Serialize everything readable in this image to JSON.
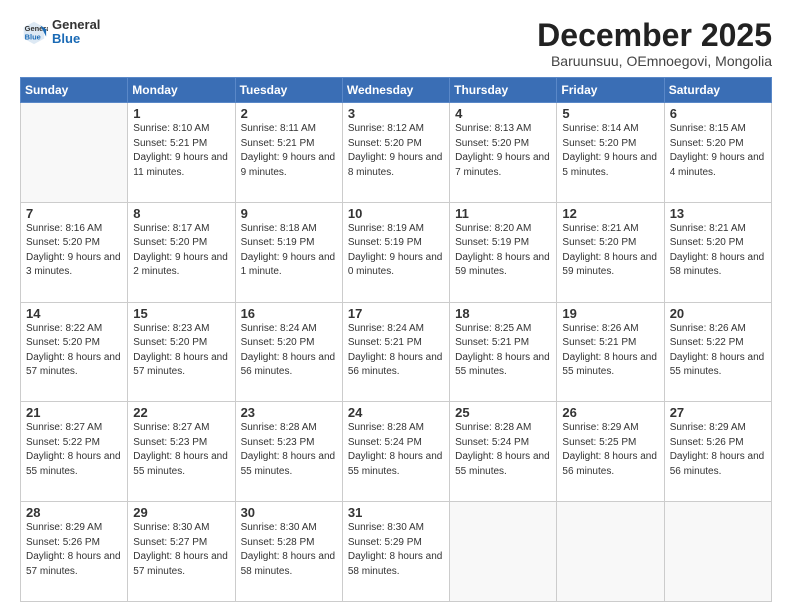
{
  "header": {
    "logo_general": "General",
    "logo_blue": "Blue",
    "month_title": "December 2025",
    "subtitle": "Baruunsuu, OEmnoegovi, Mongolia"
  },
  "days_of_week": [
    "Sunday",
    "Monday",
    "Tuesday",
    "Wednesday",
    "Thursday",
    "Friday",
    "Saturday"
  ],
  "weeks": [
    [
      {
        "day": "",
        "empty": true
      },
      {
        "day": "1",
        "sunrise": "8:10 AM",
        "sunset": "5:21 PM",
        "daylight": "9 hours and 11 minutes."
      },
      {
        "day": "2",
        "sunrise": "8:11 AM",
        "sunset": "5:21 PM",
        "daylight": "9 hours and 9 minutes."
      },
      {
        "day": "3",
        "sunrise": "8:12 AM",
        "sunset": "5:20 PM",
        "daylight": "9 hours and 8 minutes."
      },
      {
        "day": "4",
        "sunrise": "8:13 AM",
        "sunset": "5:20 PM",
        "daylight": "9 hours and 7 minutes."
      },
      {
        "day": "5",
        "sunrise": "8:14 AM",
        "sunset": "5:20 PM",
        "daylight": "9 hours and 5 minutes."
      },
      {
        "day": "6",
        "sunrise": "8:15 AM",
        "sunset": "5:20 PM",
        "daylight": "9 hours and 4 minutes."
      }
    ],
    [
      {
        "day": "7",
        "sunrise": "8:16 AM",
        "sunset": "5:20 PM",
        "daylight": "9 hours and 3 minutes."
      },
      {
        "day": "8",
        "sunrise": "8:17 AM",
        "sunset": "5:20 PM",
        "daylight": "9 hours and 2 minutes."
      },
      {
        "day": "9",
        "sunrise": "8:18 AM",
        "sunset": "5:19 PM",
        "daylight": "9 hours and 1 minute."
      },
      {
        "day": "10",
        "sunrise": "8:19 AM",
        "sunset": "5:19 PM",
        "daylight": "9 hours and 0 minutes."
      },
      {
        "day": "11",
        "sunrise": "8:20 AM",
        "sunset": "5:19 PM",
        "daylight": "8 hours and 59 minutes."
      },
      {
        "day": "12",
        "sunrise": "8:21 AM",
        "sunset": "5:20 PM",
        "daylight": "8 hours and 59 minutes."
      },
      {
        "day": "13",
        "sunrise": "8:21 AM",
        "sunset": "5:20 PM",
        "daylight": "8 hours and 58 minutes."
      }
    ],
    [
      {
        "day": "14",
        "sunrise": "8:22 AM",
        "sunset": "5:20 PM",
        "daylight": "8 hours and 57 minutes."
      },
      {
        "day": "15",
        "sunrise": "8:23 AM",
        "sunset": "5:20 PM",
        "daylight": "8 hours and 57 minutes."
      },
      {
        "day": "16",
        "sunrise": "8:24 AM",
        "sunset": "5:20 PM",
        "daylight": "8 hours and 56 minutes."
      },
      {
        "day": "17",
        "sunrise": "8:24 AM",
        "sunset": "5:21 PM",
        "daylight": "8 hours and 56 minutes."
      },
      {
        "day": "18",
        "sunrise": "8:25 AM",
        "sunset": "5:21 PM",
        "daylight": "8 hours and 55 minutes."
      },
      {
        "day": "19",
        "sunrise": "8:26 AM",
        "sunset": "5:21 PM",
        "daylight": "8 hours and 55 minutes."
      },
      {
        "day": "20",
        "sunrise": "8:26 AM",
        "sunset": "5:22 PM",
        "daylight": "8 hours and 55 minutes."
      }
    ],
    [
      {
        "day": "21",
        "sunrise": "8:27 AM",
        "sunset": "5:22 PM",
        "daylight": "8 hours and 55 minutes."
      },
      {
        "day": "22",
        "sunrise": "8:27 AM",
        "sunset": "5:23 PM",
        "daylight": "8 hours and 55 minutes."
      },
      {
        "day": "23",
        "sunrise": "8:28 AM",
        "sunset": "5:23 PM",
        "daylight": "8 hours and 55 minutes."
      },
      {
        "day": "24",
        "sunrise": "8:28 AM",
        "sunset": "5:24 PM",
        "daylight": "8 hours and 55 minutes."
      },
      {
        "day": "25",
        "sunrise": "8:28 AM",
        "sunset": "5:24 PM",
        "daylight": "8 hours and 55 minutes."
      },
      {
        "day": "26",
        "sunrise": "8:29 AM",
        "sunset": "5:25 PM",
        "daylight": "8 hours and 56 minutes."
      },
      {
        "day": "27",
        "sunrise": "8:29 AM",
        "sunset": "5:26 PM",
        "daylight": "8 hours and 56 minutes."
      }
    ],
    [
      {
        "day": "28",
        "sunrise": "8:29 AM",
        "sunset": "5:26 PM",
        "daylight": "8 hours and 57 minutes."
      },
      {
        "day": "29",
        "sunrise": "8:30 AM",
        "sunset": "5:27 PM",
        "daylight": "8 hours and 57 minutes."
      },
      {
        "day": "30",
        "sunrise": "8:30 AM",
        "sunset": "5:28 PM",
        "daylight": "8 hours and 58 minutes."
      },
      {
        "day": "31",
        "sunrise": "8:30 AM",
        "sunset": "5:29 PM",
        "daylight": "8 hours and 58 minutes."
      },
      {
        "day": "",
        "empty": true
      },
      {
        "day": "",
        "empty": true
      },
      {
        "day": "",
        "empty": true
      }
    ]
  ]
}
